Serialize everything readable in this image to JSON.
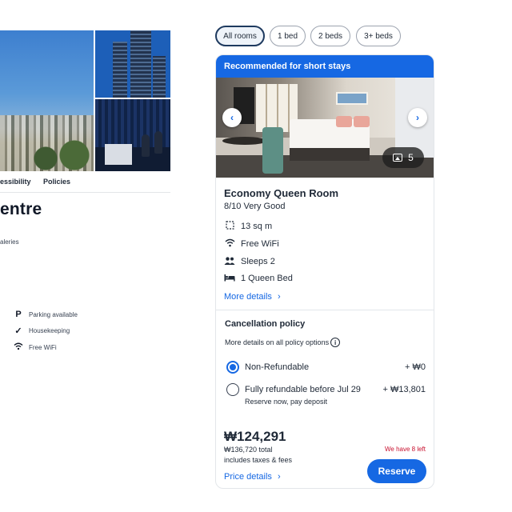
{
  "left_panel": {
    "tabs": [
      "essibility",
      "Policies"
    ],
    "title": "entre",
    "fragment_text": "aleries",
    "amenities": [
      {
        "icon": "parking-icon",
        "label": "Parking available"
      },
      {
        "icon": "housekeeping-check-icon",
        "label": "Housekeeping"
      },
      {
        "icon": "wifi-icon",
        "label": "Free WiFi"
      }
    ]
  },
  "filters": {
    "chips": [
      "All rooms",
      "1 bed",
      "2 beds",
      "3+ beds"
    ],
    "selected": "All rooms"
  },
  "room_card": {
    "banner": "Recommended for short stays",
    "photo_count": "5",
    "name": "Economy Queen Room",
    "rating": "8/10 Very Good",
    "features": [
      {
        "icon": "floor-area-icon",
        "label": "13 sq m"
      },
      {
        "icon": "wifi-icon",
        "label": "Free WiFi"
      },
      {
        "icon": "people-icon",
        "label": "Sleeps 2"
      },
      {
        "icon": "bed-icon",
        "label": "1 Queen Bed"
      }
    ],
    "more_details": "More details",
    "cancellation": {
      "title": "Cancellation policy",
      "subtitle": "More details on all policy options",
      "options": [
        {
          "label": "Non-Refundable",
          "price": "+ ₩0",
          "selected": true
        },
        {
          "label": "Fully refundable before Jul 29",
          "price": "+ ₩13,801",
          "sub": "Reserve now, pay deposit",
          "selected": false
        }
      ]
    },
    "price": "₩124,291",
    "total": "₩136,720 total",
    "tax_note": "includes taxes & fees",
    "availability": "We have 8 left",
    "price_details": "Price details",
    "reserve_label": "Reserve"
  },
  "colors": {
    "accent": "#1668e3",
    "urgency": "#c8102e",
    "chip_active_border": "#1e3a5f"
  }
}
